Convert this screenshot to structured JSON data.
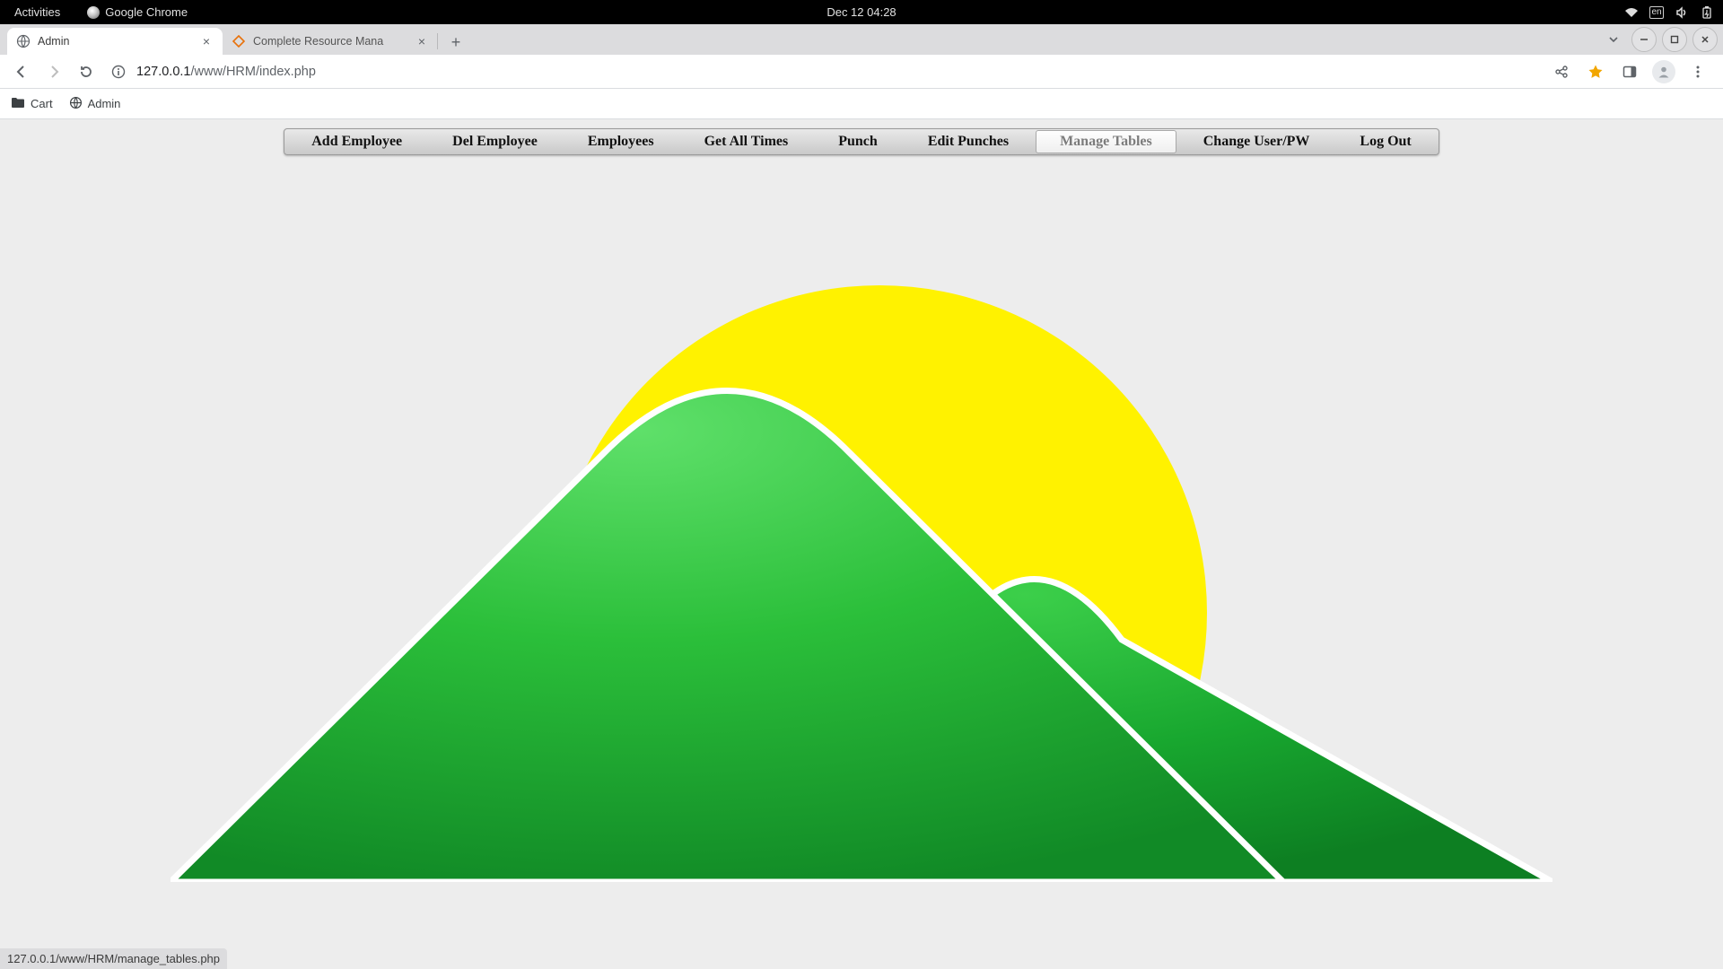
{
  "gnome": {
    "activities": "Activities",
    "app_name": "Google Chrome",
    "datetime": "Dec 12  04:28"
  },
  "tabs": [
    {
      "title": "Admin",
      "favicon": "globe"
    },
    {
      "title": "Complete Resource Mana",
      "favicon": "diamond"
    }
  ],
  "url": {
    "host": "127.0.0.1",
    "path": "/www/HRM/index.php"
  },
  "bookmarks": [
    {
      "label": "Cart",
      "icon": "folder"
    },
    {
      "label": "Admin",
      "icon": "globe"
    }
  ],
  "menu": {
    "items": [
      "Add Employee",
      "Del Employee",
      "Employees",
      "Get All Times",
      "Punch",
      "Edit Punches",
      "Manage Tables",
      "Change User/PW",
      "Log Out"
    ],
    "hovered_index": 6
  },
  "status_text": "127.0.0.1/www/HRM/manage_tables.php"
}
